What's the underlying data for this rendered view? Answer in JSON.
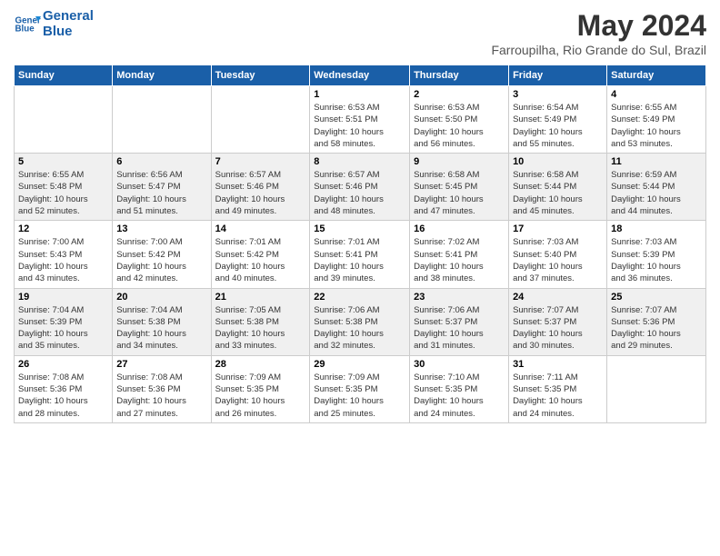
{
  "header": {
    "logo_line1": "General",
    "logo_line2": "Blue",
    "title": "May 2024",
    "subtitle": "Farroupilha, Rio Grande do Sul, Brazil"
  },
  "calendar": {
    "headers": [
      "Sunday",
      "Monday",
      "Tuesday",
      "Wednesday",
      "Thursday",
      "Friday",
      "Saturday"
    ],
    "weeks": [
      {
        "days": [
          {
            "num": "",
            "info": ""
          },
          {
            "num": "",
            "info": ""
          },
          {
            "num": "",
            "info": ""
          },
          {
            "num": "1",
            "info": "Sunrise: 6:53 AM\nSunset: 5:51 PM\nDaylight: 10 hours\nand 58 minutes."
          },
          {
            "num": "2",
            "info": "Sunrise: 6:53 AM\nSunset: 5:50 PM\nDaylight: 10 hours\nand 56 minutes."
          },
          {
            "num": "3",
            "info": "Sunrise: 6:54 AM\nSunset: 5:49 PM\nDaylight: 10 hours\nand 55 minutes."
          },
          {
            "num": "4",
            "info": "Sunrise: 6:55 AM\nSunset: 5:49 PM\nDaylight: 10 hours\nand 53 minutes."
          }
        ]
      },
      {
        "days": [
          {
            "num": "5",
            "info": "Sunrise: 6:55 AM\nSunset: 5:48 PM\nDaylight: 10 hours\nand 52 minutes."
          },
          {
            "num": "6",
            "info": "Sunrise: 6:56 AM\nSunset: 5:47 PM\nDaylight: 10 hours\nand 51 minutes."
          },
          {
            "num": "7",
            "info": "Sunrise: 6:57 AM\nSunset: 5:46 PM\nDaylight: 10 hours\nand 49 minutes."
          },
          {
            "num": "8",
            "info": "Sunrise: 6:57 AM\nSunset: 5:46 PM\nDaylight: 10 hours\nand 48 minutes."
          },
          {
            "num": "9",
            "info": "Sunrise: 6:58 AM\nSunset: 5:45 PM\nDaylight: 10 hours\nand 47 minutes."
          },
          {
            "num": "10",
            "info": "Sunrise: 6:58 AM\nSunset: 5:44 PM\nDaylight: 10 hours\nand 45 minutes."
          },
          {
            "num": "11",
            "info": "Sunrise: 6:59 AM\nSunset: 5:44 PM\nDaylight: 10 hours\nand 44 minutes."
          }
        ]
      },
      {
        "days": [
          {
            "num": "12",
            "info": "Sunrise: 7:00 AM\nSunset: 5:43 PM\nDaylight: 10 hours\nand 43 minutes."
          },
          {
            "num": "13",
            "info": "Sunrise: 7:00 AM\nSunset: 5:42 PM\nDaylight: 10 hours\nand 42 minutes."
          },
          {
            "num": "14",
            "info": "Sunrise: 7:01 AM\nSunset: 5:42 PM\nDaylight: 10 hours\nand 40 minutes."
          },
          {
            "num": "15",
            "info": "Sunrise: 7:01 AM\nSunset: 5:41 PM\nDaylight: 10 hours\nand 39 minutes."
          },
          {
            "num": "16",
            "info": "Sunrise: 7:02 AM\nSunset: 5:41 PM\nDaylight: 10 hours\nand 38 minutes."
          },
          {
            "num": "17",
            "info": "Sunrise: 7:03 AM\nSunset: 5:40 PM\nDaylight: 10 hours\nand 37 minutes."
          },
          {
            "num": "18",
            "info": "Sunrise: 7:03 AM\nSunset: 5:39 PM\nDaylight: 10 hours\nand 36 minutes."
          }
        ]
      },
      {
        "days": [
          {
            "num": "19",
            "info": "Sunrise: 7:04 AM\nSunset: 5:39 PM\nDaylight: 10 hours\nand 35 minutes."
          },
          {
            "num": "20",
            "info": "Sunrise: 7:04 AM\nSunset: 5:38 PM\nDaylight: 10 hours\nand 34 minutes."
          },
          {
            "num": "21",
            "info": "Sunrise: 7:05 AM\nSunset: 5:38 PM\nDaylight: 10 hours\nand 33 minutes."
          },
          {
            "num": "22",
            "info": "Sunrise: 7:06 AM\nSunset: 5:38 PM\nDaylight: 10 hours\nand 32 minutes."
          },
          {
            "num": "23",
            "info": "Sunrise: 7:06 AM\nSunset: 5:37 PM\nDaylight: 10 hours\nand 31 minutes."
          },
          {
            "num": "24",
            "info": "Sunrise: 7:07 AM\nSunset: 5:37 PM\nDaylight: 10 hours\nand 30 minutes."
          },
          {
            "num": "25",
            "info": "Sunrise: 7:07 AM\nSunset: 5:36 PM\nDaylight: 10 hours\nand 29 minutes."
          }
        ]
      },
      {
        "days": [
          {
            "num": "26",
            "info": "Sunrise: 7:08 AM\nSunset: 5:36 PM\nDaylight: 10 hours\nand 28 minutes."
          },
          {
            "num": "27",
            "info": "Sunrise: 7:08 AM\nSunset: 5:36 PM\nDaylight: 10 hours\nand 27 minutes."
          },
          {
            "num": "28",
            "info": "Sunrise: 7:09 AM\nSunset: 5:35 PM\nDaylight: 10 hours\nand 26 minutes."
          },
          {
            "num": "29",
            "info": "Sunrise: 7:09 AM\nSunset: 5:35 PM\nDaylight: 10 hours\nand 25 minutes."
          },
          {
            "num": "30",
            "info": "Sunrise: 7:10 AM\nSunset: 5:35 PM\nDaylight: 10 hours\nand 24 minutes."
          },
          {
            "num": "31",
            "info": "Sunrise: 7:11 AM\nSunset: 5:35 PM\nDaylight: 10 hours\nand 24 minutes."
          },
          {
            "num": "",
            "info": ""
          }
        ]
      }
    ]
  }
}
